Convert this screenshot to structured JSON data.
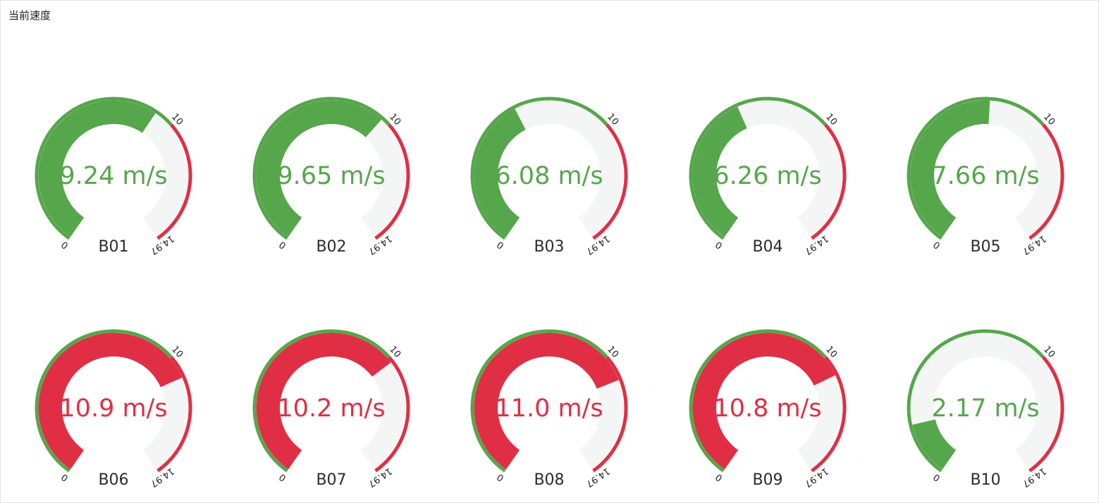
{
  "panel": {
    "title": "当前速度"
  },
  "colors": {
    "ok": "#56a64b",
    "alert": "#e02f44",
    "track": "#f4f5f5"
  },
  "chart_data": {
    "type": "gauge",
    "unit": "m/s",
    "min": 0,
    "max": 14.97,
    "threshold": 10,
    "tick_labels": [
      "0",
      "10",
      "14.97"
    ],
    "gauges": [
      {
        "name": "B01",
        "value": 9.24,
        "display": "9.24 m/s"
      },
      {
        "name": "B02",
        "value": 9.65,
        "display": "9.65 m/s"
      },
      {
        "name": "B03",
        "value": 6.08,
        "display": "6.08 m/s"
      },
      {
        "name": "B04",
        "value": 6.26,
        "display": "6.26 m/s"
      },
      {
        "name": "B05",
        "value": 7.66,
        "display": "7.66 m/s"
      },
      {
        "name": "B06",
        "value": 10.9,
        "display": "10.9 m/s"
      },
      {
        "name": "B07",
        "value": 10.2,
        "display": "10.2 m/s"
      },
      {
        "name": "B08",
        "value": 11.0,
        "display": "11.0 m/s"
      },
      {
        "name": "B09",
        "value": 10.8,
        "display": "10.8 m/s"
      },
      {
        "name": "B10",
        "value": 2.17,
        "display": "2.17 m/s"
      }
    ]
  }
}
